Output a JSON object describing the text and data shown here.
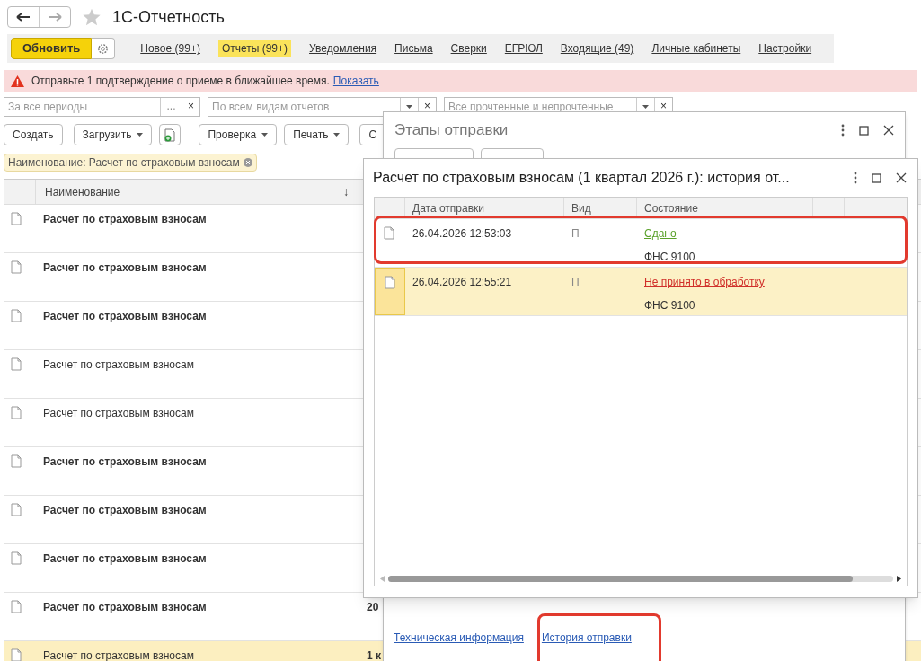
{
  "window": {
    "title": "1С-Отчетность"
  },
  "toolbar": {
    "refresh": "Обновить",
    "links": [
      {
        "label": "Новое (99+)",
        "selected": false
      },
      {
        "label": "Отчеты (99+)",
        "selected": true
      },
      {
        "label": "Уведомления",
        "selected": false
      },
      {
        "label": "Письма",
        "selected": false
      },
      {
        "label": "Сверки",
        "selected": false
      },
      {
        "label": "ЕГРЮЛ",
        "selected": false
      },
      {
        "label": "Входящие (49)",
        "selected": false
      },
      {
        "label": "Личные кабинеты",
        "selected": false
      },
      {
        "label": "Настройки",
        "selected": false
      }
    ]
  },
  "alert": {
    "text": "Отправьте 1 подтверждение о приеме в ближайшее время.",
    "link": "Показать"
  },
  "filters": {
    "period": {
      "placeholder": "За все периоды",
      "button": "..."
    },
    "kind": {
      "placeholder": "По всем видам отчетов"
    },
    "read": {
      "placeholder": "Все прочтенные и непрочтенные"
    },
    "clear": "×"
  },
  "actions": [
    {
      "label": "Создать",
      "kind": "plain"
    },
    {
      "label": "Загрузить",
      "kind": "menu"
    },
    {
      "kind": "icon"
    },
    {
      "label": "Проверка",
      "kind": "menu"
    },
    {
      "label": "Печать",
      "kind": "menu"
    },
    {
      "label": "С",
      "kind": "plain"
    }
  ],
  "filter_tag": "Наименование: Расчет по страховым взносам",
  "table": {
    "columns": [
      "Наименование"
    ],
    "sort": "↓",
    "rows": [
      {
        "name": "Расчет по страховым взносам",
        "bold": true,
        "selected": false
      },
      {
        "name": "Расчет по страховым взносам",
        "bold": true,
        "selected": false
      },
      {
        "name": "Расчет по страховым взносам",
        "bold": true,
        "selected": false
      },
      {
        "name": "Расчет по страховым взносам",
        "bold": false,
        "selected": false
      },
      {
        "name": "Расчет по страховым взносам",
        "bold": false,
        "selected": false
      },
      {
        "name": "Расчет по страховым взносам",
        "bold": true,
        "selected": false
      },
      {
        "name": "Расчет по страховым взносам",
        "bold": true,
        "selected": false
      },
      {
        "name": "Расчет по страховым взносам",
        "bold": true,
        "selected": false
      },
      {
        "name": "Расчет по страховым взносам",
        "bold": true,
        "selected": false,
        "column_2": "20"
      },
      {
        "name": "Расчет по страховым взносам",
        "bold": false,
        "selected": true,
        "column_2": "1 к"
      }
    ]
  },
  "stages_dialog": {
    "title": "Этапы отправки",
    "links": [
      "Техническая информация",
      "История отправки"
    ]
  },
  "history_dialog": {
    "title": "Расчет по страховым взносам (1 квартал 2026 г.): история от...",
    "columns": [
      "Дата отправки",
      "Вид",
      "Состояние"
    ],
    "rows": [
      {
        "date": "26.04.2026 12:53:03",
        "type": "П",
        "status": "Сдано",
        "kind": "success",
        "authority": "ФНС 9100",
        "selected": false
      },
      {
        "date": "26.04.2026 12:55:21",
        "type": "П",
        "status": "Не принято в обработку",
        "kind": "error",
        "authority": "ФНС 9100",
        "selected": true
      }
    ]
  }
}
